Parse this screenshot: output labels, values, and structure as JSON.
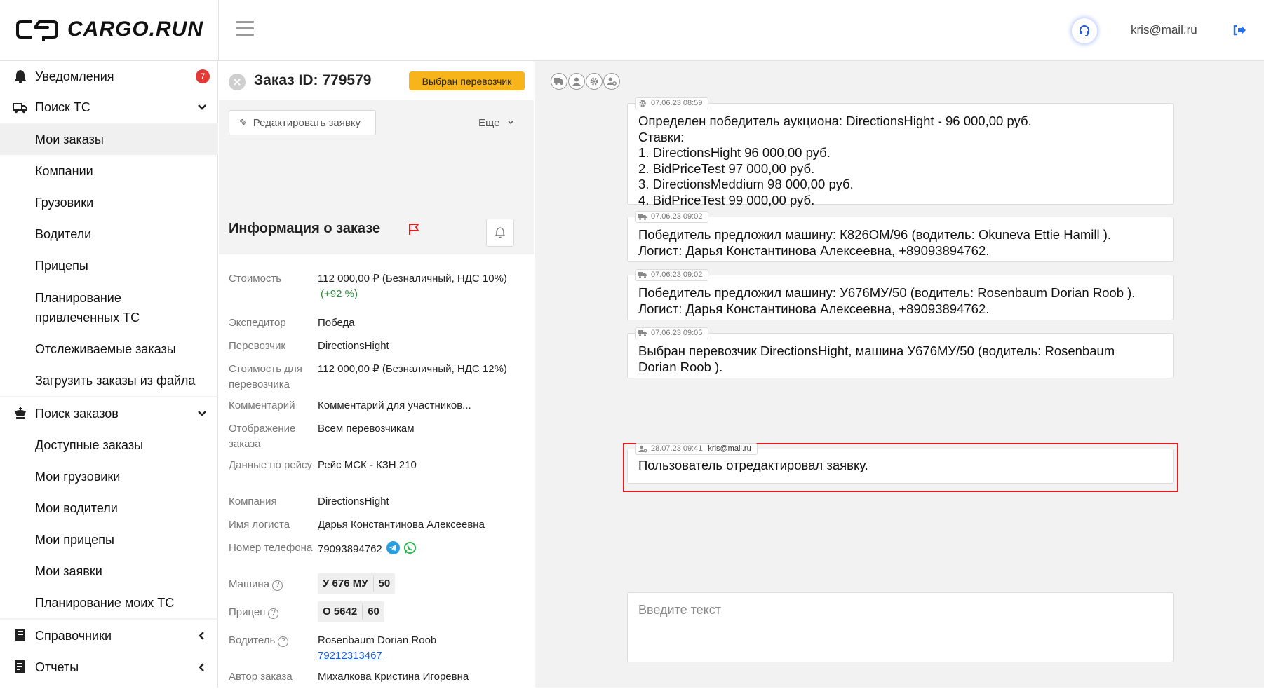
{
  "header": {
    "brand": "CARGO.RUN",
    "user_email": "kris@mail.ru"
  },
  "sidebar": {
    "notifications": {
      "label": "Уведомления",
      "count": "7"
    },
    "search_vehicles": {
      "label": "Поиск ТС",
      "items": [
        "Мои заказы",
        "Компании",
        "Грузовики",
        "Водители",
        "Прицепы",
        "Планирование\nпривлеченных ТС",
        "Отслеживаемые заказы",
        "Загрузить заказы из файла"
      ]
    },
    "search_orders": {
      "label": "Поиск заказов",
      "items": [
        "Доступные заказы",
        "Мои грузовики",
        "Мои водители",
        "Мои прицепы",
        "Мои заявки",
        "Планирование моих ТС"
      ]
    },
    "references": "Справочники",
    "reports": "Отчеты"
  },
  "order": {
    "title": "Заказ ID: 779579",
    "status": "Выбран перевозчик",
    "edit_label": "Редактировать заявку",
    "more_label": "Еще",
    "info_heading": "Информация о заказе",
    "fields": {
      "cost_label": "Стоимость",
      "cost_value": "112 000,00 ₽ (Безналичный, НДС 10%)",
      "cost_delta": "(+92 %)",
      "forwarder_label": "Экспедитор",
      "forwarder_value": "Победа",
      "carrier_label": "Перевозчик",
      "carrier_value": "DirectionsHight",
      "carrier_cost_label": "Стоимость для перевозчика",
      "carrier_cost_value": "112 000,00 ₽ (Безналичный, НДС 12%)",
      "comment_label": "Комментарий",
      "comment_value": "Комментарий для участников...",
      "display_label": "Отображение заказа",
      "display_value": "Всем перевозчикам",
      "trip_label": "Данные по рейсу",
      "trip_value": "Рейс МСК - КЗН 210",
      "company_label": "Компания",
      "company_value": "DirectionsHight",
      "logist_label": "Имя логиста",
      "logist_value": "Дарья Константинова Алексеевна",
      "phone_label": "Номер телефона",
      "phone_value": "79093894762",
      "truck_label": "Машина",
      "truck_plate": "У 676 МУ",
      "truck_region": "50",
      "trailer_label": "Прицеп",
      "trailer_plate": "О 5642",
      "trailer_region": "60",
      "driver_label": "Водитель",
      "driver_name": "Rosenbaum Dorian Roob",
      "driver_phone": "79212313467",
      "author_label": "Автор заказа",
      "author_value": "Михалкова Кристина Игоревна"
    }
  },
  "chat": {
    "messages": [
      {
        "icon": "gear-icon",
        "time": "07.06.23 08:59",
        "author": "",
        "text": "Определен победитель аукциона: DirectionsHight - 96 000,00 руб.\nСтавки:\n1. DirectionsHight 96 000,00 руб.\n2. BidPriceTest 97 000,00 руб.\n3. DirectionsMeddium 98 000,00 руб.\n4. BidPriceTest 99 000,00 руб."
      },
      {
        "icon": "truck-icon",
        "time": "07.06.23 09:02",
        "author": "",
        "text": "Победитель предложил машину: К826ОМ/96 (водитель:  Okuneva Ettie Hamill ).\nЛогист: Дарья Константинова Алексеевна, +89093894762."
      },
      {
        "icon": "truck-icon",
        "time": "07.06.23 09:02",
        "author": "",
        "text": "Победитель предложил машину: У676МУ/50 (водитель:  Rosenbaum Dorian Roob ).\nЛогист: Дарья Константинова Алексеевна, +89093894762."
      },
      {
        "icon": "truck-icon",
        "time": "07.06.23 09:05",
        "author": "",
        "text": "Выбран перевозчик DirectionsHight, машина У676МУ/50 (водитель:  Rosenbaum\nDorian Roob )."
      },
      {
        "icon": "user-gear-icon",
        "time": "28.07.23 09:41",
        "author": "kris@mail.ru",
        "text": "Пользователь отредактировал заявку."
      }
    ],
    "input_placeholder": "Введите текст"
  },
  "colors": {
    "accent": "#f7b51b",
    "badge": "#e53935",
    "highlight": "#e02020",
    "link": "#1a5de0",
    "positive": "#2e8b3a"
  }
}
